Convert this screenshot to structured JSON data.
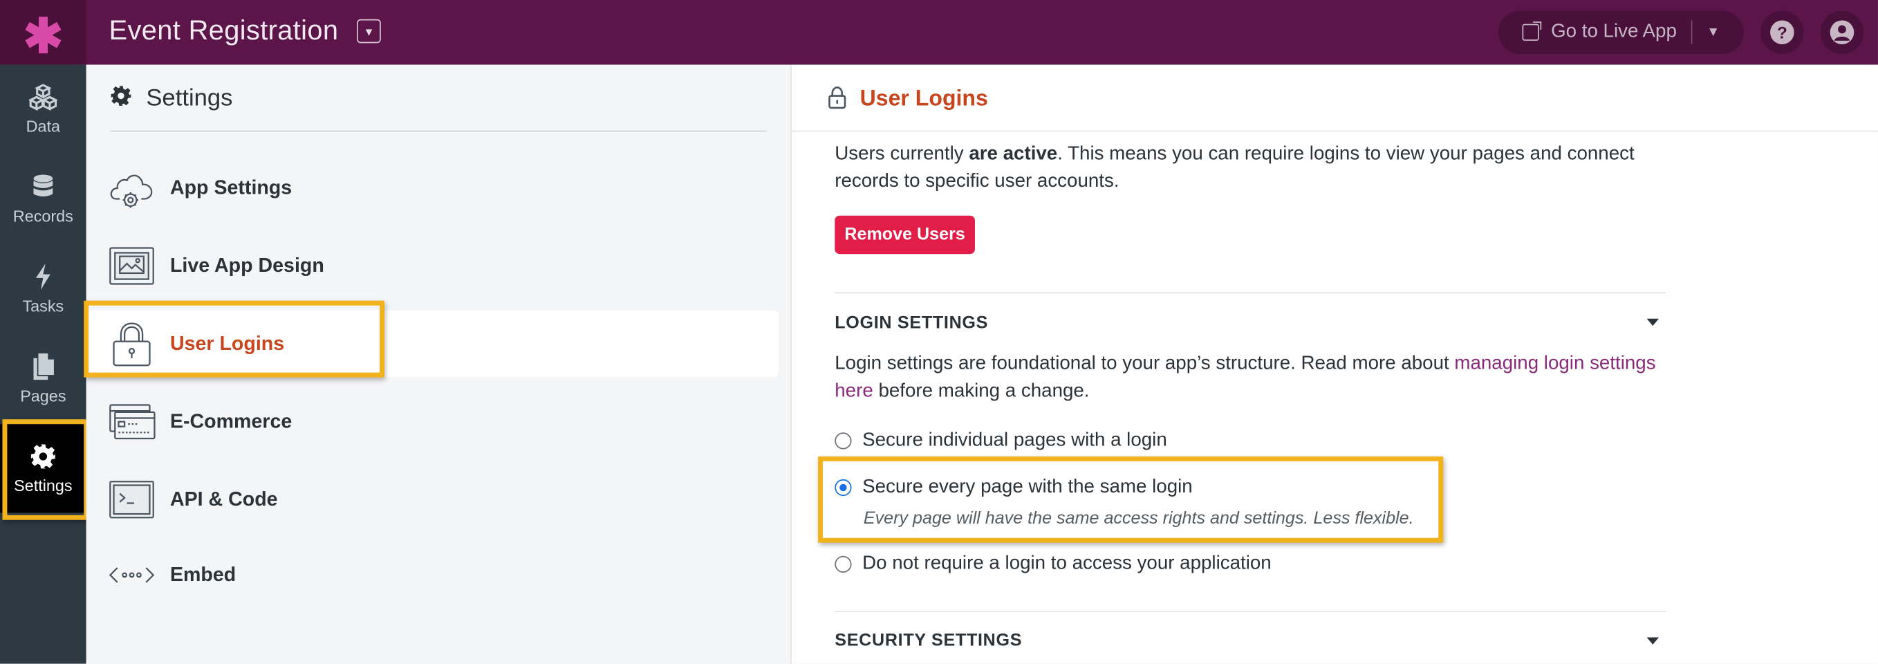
{
  "topbar": {
    "app_title": "Event Registration",
    "live_app_label": "Go to Live App",
    "help_glyph": "?"
  },
  "rail": {
    "items": [
      {
        "label": "Data",
        "icon": "cubes-icon"
      },
      {
        "label": "Records",
        "icon": "database-icon"
      },
      {
        "label": "Tasks",
        "icon": "lightning-icon"
      },
      {
        "label": "Pages",
        "icon": "pages-icon"
      },
      {
        "label": "Settings",
        "icon": "gear-icon"
      }
    ],
    "active": "Settings"
  },
  "settings_panel": {
    "title": "Settings",
    "items": [
      {
        "label": "App Settings",
        "icon": "cloud-gear-icon"
      },
      {
        "label": "Live App Design",
        "icon": "image-frame-icon"
      },
      {
        "label": "User Logins",
        "icon": "padlock-icon"
      },
      {
        "label": "E-Commerce",
        "icon": "credit-card-icon"
      },
      {
        "label": "API & Code",
        "icon": "terminal-icon"
      },
      {
        "label": "Embed",
        "icon": "embed-code-icon"
      }
    ],
    "active": "User Logins"
  },
  "content": {
    "title": "User Logins",
    "status_prefix": "Users currently ",
    "status_bold": "are active",
    "status_suffix": ". This means you can require logins to view your pages and connect records to specific user accounts.",
    "remove_button": "Remove Users",
    "login_settings": {
      "heading": "LOGIN SETTINGS",
      "desc_prefix": "Login settings are foundational to your app’s structure. Read more about ",
      "desc_link": "managing login settings here",
      "desc_suffix": " before making a change.",
      "options": [
        {
          "label": "Secure individual pages with a login",
          "selected": false
        },
        {
          "label": "Secure every page with the same login",
          "selected": true,
          "hint": "Every page will have the same access rights and settings. Less flexible."
        },
        {
          "label": "Do not require a login to access your application",
          "selected": false
        }
      ]
    },
    "security_settings": {
      "heading": "SECURITY SETTINGS"
    }
  },
  "colors": {
    "topbar": "#5b1548",
    "rail": "#2d3a43",
    "accent_orange": "#c7461e",
    "highlight": "#f2b21c",
    "danger": "#e11d48",
    "link": "#8a2b7a"
  }
}
